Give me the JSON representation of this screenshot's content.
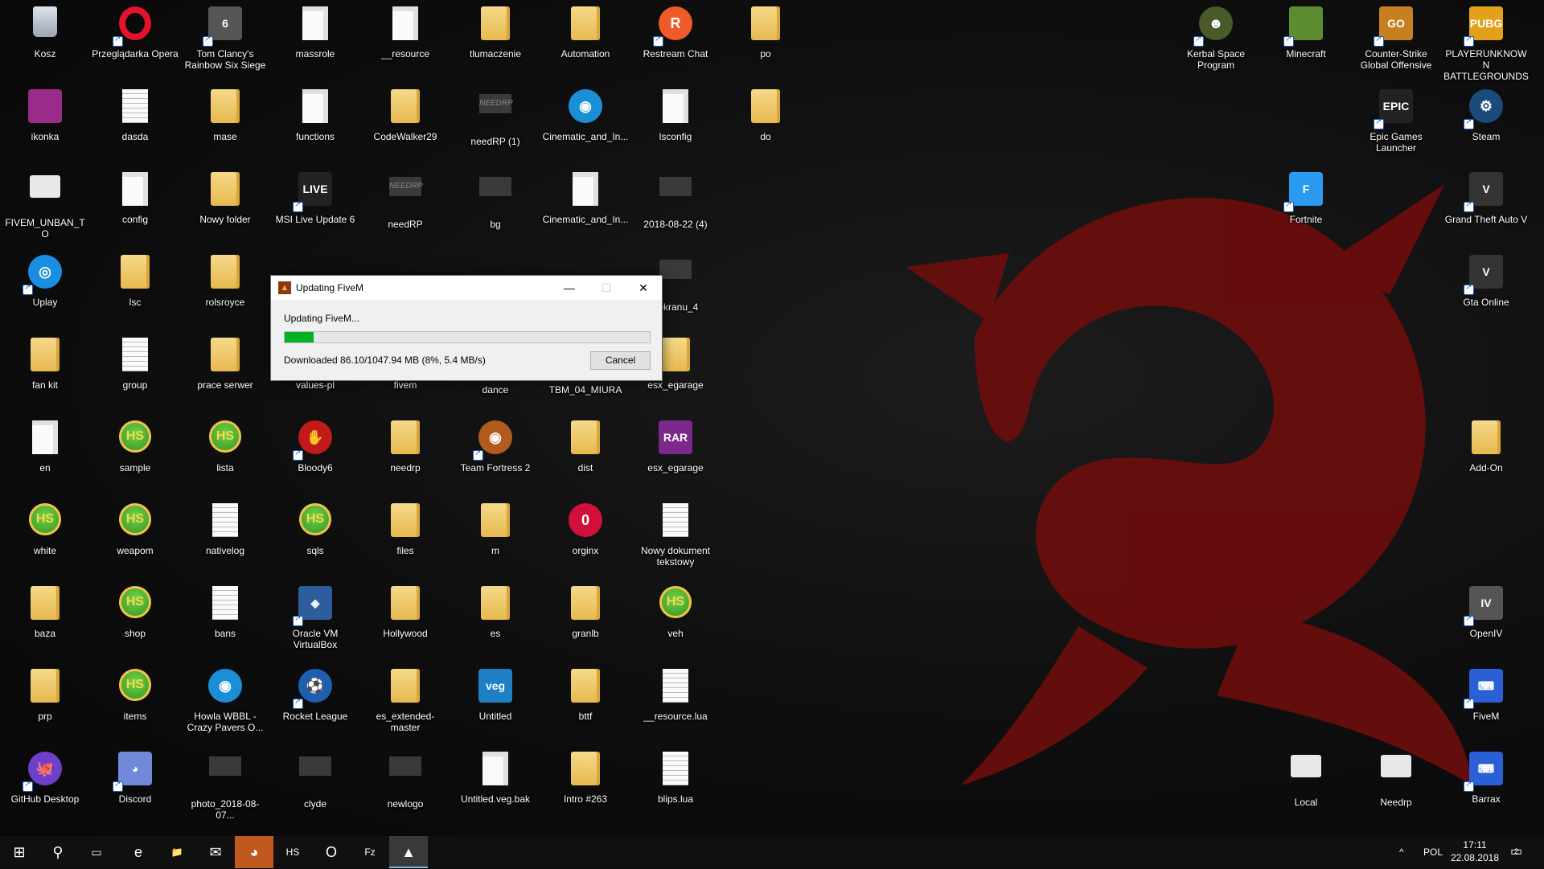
{
  "desktop": {
    "icons": [
      {
        "label": "Kosz",
        "glyph": "bin"
      },
      {
        "label": "Przeglądarka Opera",
        "glyph": "opera",
        "shortcut": true
      },
      {
        "label": "Tom Clancy's Rainbow Six Siege",
        "glyph": "sq",
        "text": "6",
        "color": "#555",
        "shortcut": true
      },
      {
        "label": "massrole",
        "glyph": "doc"
      },
      {
        "label": "__resource",
        "glyph": "doc"
      },
      {
        "label": "tlumaczenie",
        "glyph": "folder"
      },
      {
        "label": "Automation",
        "glyph": "folder"
      },
      {
        "label": "Restream Chat",
        "glyph": "circle",
        "text": "R",
        "color": "#f05a28",
        "shortcut": true
      },
      {
        "label": "po",
        "glyph": "folder"
      },
      {
        "label": "ikonka",
        "glyph": "sq",
        "text": "",
        "color": "#9a2b8a"
      },
      {
        "label": "dasda",
        "glyph": "doclines"
      },
      {
        "label": "mase",
        "glyph": "folder"
      },
      {
        "label": "functions",
        "glyph": "doc"
      },
      {
        "label": "CodeWalker29",
        "glyph": "folder"
      },
      {
        "label": "needRP (1)",
        "glyph": "dark",
        "text": "NEEDRP"
      },
      {
        "label": "Cinematic_and_In...",
        "glyph": "circle",
        "text": "◉",
        "color": "#1b8fd6"
      },
      {
        "label": "lsconfig",
        "glyph": "doc"
      },
      {
        "label": "do",
        "glyph": "folder"
      },
      {
        "label": "FIVEM_UNBAN_TO",
        "glyph": "gear"
      },
      {
        "label": "config",
        "glyph": "doc"
      },
      {
        "label": "Nowy folder",
        "glyph": "folder"
      },
      {
        "label": "MSI Live Update 6",
        "glyph": "sq",
        "text": "LIVE",
        "color": "#222",
        "shortcut": true
      },
      {
        "label": "needRP",
        "glyph": "dark",
        "text": "NEEDRP"
      },
      {
        "label": "bg",
        "glyph": "dark",
        "text": ""
      },
      {
        "label": "Cinematic_and_In...",
        "glyph": "doc"
      },
      {
        "label": "2018-08-22 (4)",
        "glyph": "dark",
        "text": ""
      },
      {
        "label": "Uplay",
        "glyph": "circle",
        "text": "◎",
        "color": "#1a8ee0",
        "shortcut": true
      },
      {
        "label": "lsc",
        "glyph": "folder"
      },
      {
        "label": "rolsroyce",
        "glyph": "folder"
      },
      {
        "label": "_ekranu_4",
        "glyph": "dark",
        "text": ""
      },
      {
        "label": "fan kit",
        "glyph": "folder"
      },
      {
        "label": "group",
        "glyph": "doclines"
      },
      {
        "label": "prace serwer",
        "glyph": "folder"
      },
      {
        "label": "values-pl",
        "glyph": "doc"
      },
      {
        "label": "fivem",
        "glyph": "folder"
      },
      {
        "label": "dance",
        "glyph": "dark",
        "text": ""
      },
      {
        "label": "TBM_04_MIURA",
        "glyph": "dark",
        "text": ""
      },
      {
        "label": "esx_egarage",
        "glyph": "folder"
      },
      {
        "label": "en",
        "glyph": "doc"
      },
      {
        "label": "sample",
        "glyph": "hs"
      },
      {
        "label": "lista",
        "glyph": "hs"
      },
      {
        "label": "Bloody6",
        "glyph": "circle",
        "text": "✋",
        "color": "#c21a1a",
        "shortcut": true
      },
      {
        "label": "needrp",
        "glyph": "folder"
      },
      {
        "label": "Team Fortress 2",
        "glyph": "circle",
        "text": "◉",
        "color": "#b35a1f",
        "shortcut": true
      },
      {
        "label": "dist",
        "glyph": "folder"
      },
      {
        "label": "esx_egarage",
        "glyph": "sq",
        "text": "RAR",
        "color": "#7b2a8c"
      },
      {
        "label": "white",
        "glyph": "hs"
      },
      {
        "label": "weapom",
        "glyph": "hs"
      },
      {
        "label": "nativelog",
        "glyph": "doclines"
      },
      {
        "label": "sqls",
        "glyph": "hs"
      },
      {
        "label": "files",
        "glyph": "folder"
      },
      {
        "label": "m",
        "glyph": "folder"
      },
      {
        "label": "orginx",
        "glyph": "circle",
        "text": "0",
        "color": "#d0103a"
      },
      {
        "label": "Nowy dokument tekstowy",
        "glyph": "doclines"
      },
      {
        "label": "baza",
        "glyph": "folder"
      },
      {
        "label": "shop",
        "glyph": "hs"
      },
      {
        "label": "bans",
        "glyph": "doclines"
      },
      {
        "label": "Oracle VM VirtualBox",
        "glyph": "sq",
        "text": "◈",
        "color": "#2e5d9e",
        "shortcut": true
      },
      {
        "label": "Hollywood",
        "glyph": "folder"
      },
      {
        "label": "es",
        "glyph": "folder"
      },
      {
        "label": "granlb",
        "glyph": "folder"
      },
      {
        "label": "veh",
        "glyph": "hs"
      },
      {
        "label": "prp",
        "glyph": "folder"
      },
      {
        "label": "items",
        "glyph": "hs"
      },
      {
        "label": "Howla WBBL - Crazy Pavers O...",
        "glyph": "circle",
        "text": "◉",
        "color": "#1b8fd6"
      },
      {
        "label": "Rocket League",
        "glyph": "circle",
        "text": "⚽",
        "color": "#1f5fb0",
        "shortcut": true
      },
      {
        "label": "es_extended-master",
        "glyph": "folder"
      },
      {
        "label": "Untitled",
        "glyph": "sq",
        "text": "veg",
        "color": "#1d7fc4"
      },
      {
        "label": "bttf",
        "glyph": "folder"
      },
      {
        "label": "__resource.lua",
        "glyph": "doclines"
      },
      {
        "label": "GitHub Desktop",
        "glyph": "circle",
        "text": "🐙",
        "color": "#6e40c9",
        "shortcut": true
      },
      {
        "label": "Discord",
        "glyph": "sq",
        "text": "◕",
        "color": "#7289da",
        "shortcut": true
      },
      {
        "label": "photo_2018-08-07...",
        "glyph": "dark",
        "text": ""
      },
      {
        "label": "clyde",
        "glyph": "dark",
        "text": ""
      },
      {
        "label": "newlogo",
        "glyph": "dark",
        "text": ""
      },
      {
        "label": "Untitled.veg.bak",
        "glyph": "doc"
      },
      {
        "label": "Intro #263",
        "glyph": "folder"
      },
      {
        "label": "blips.lua",
        "glyph": "doclines"
      },
      {
        "label": "Kerbal Space Program",
        "glyph": "circle",
        "text": "☻",
        "color": "#4a5a2a",
        "shortcut": true
      },
      {
        "label": "Minecraft",
        "glyph": "sq",
        "text": "",
        "color": "#5d8b2f",
        "shortcut": true
      },
      {
        "label": "Counter-Strike Global Offensive",
        "glyph": "sq",
        "text": "GO",
        "color": "#c6801f",
        "shortcut": true
      },
      {
        "label": "PLAYERUNKNOWN BATTLEGROUNDS",
        "glyph": "sq",
        "text": "PUBG",
        "color": "#e3a11a",
        "shortcut": true
      },
      {
        "label": "Epic Games Launcher",
        "glyph": "sq",
        "text": "EPIC",
        "color": "#222",
        "shortcut": true
      },
      {
        "label": "Steam",
        "glyph": "circle",
        "text": "⚙",
        "color": "#1b4b7a",
        "shortcut": true
      },
      {
        "label": "Fortnite",
        "glyph": "sq",
        "text": "F",
        "color": "#2a9bf0",
        "shortcut": true
      },
      {
        "label": "Grand Theft Auto V",
        "glyph": "sq",
        "text": "V",
        "color": "#333",
        "shortcut": true
      },
      {
        "label": "Gta Online",
        "glyph": "sq",
        "text": "V",
        "color": "#333",
        "shortcut": true
      },
      {
        "label": "Add-On",
        "glyph": "folder"
      },
      {
        "label": "OpenIV",
        "glyph": "sq",
        "text": "IV",
        "color": "#555",
        "shortcut": true
      },
      {
        "label": "FiveM",
        "glyph": "sq",
        "text": "⌨",
        "color": "#2a5fd6",
        "shortcut": true
      },
      {
        "label": "Local",
        "glyph": "gear"
      },
      {
        "label": "Needrp",
        "glyph": "gear"
      },
      {
        "label": "Barrax",
        "glyph": "sq",
        "text": "⌨",
        "color": "#2a5fd6",
        "shortcut": true
      }
    ]
  },
  "dialog": {
    "title": "Updating FiveM",
    "status": "Updating FiveM...",
    "progress_percent": 8,
    "detail": "Downloaded 86.10/1047.94 MB (8%, 5.4 MB/s)",
    "cancel_label": "Cancel",
    "minimize": "—",
    "maximize": "☐",
    "close": "✕"
  },
  "taskbar": {
    "start_icon": "⊞",
    "search_icon": "⚲",
    "taskview_icon": "▭",
    "apps": [
      {
        "name": "edge",
        "glyph": "e"
      },
      {
        "name": "file-explorer",
        "glyph": "📁"
      },
      {
        "name": "mail",
        "glyph": "✉"
      },
      {
        "name": "discord",
        "glyph": "◕"
      },
      {
        "name": "hs-app",
        "glyph": "HS"
      },
      {
        "name": "opera",
        "glyph": "O"
      },
      {
        "name": "filezilla",
        "glyph": "Fz"
      },
      {
        "name": "fivem",
        "glyph": "▲"
      }
    ],
    "tray_chevron": "^",
    "language": "POL",
    "time": "17:11",
    "date": "22.08.2018",
    "notifications_count": "2"
  }
}
